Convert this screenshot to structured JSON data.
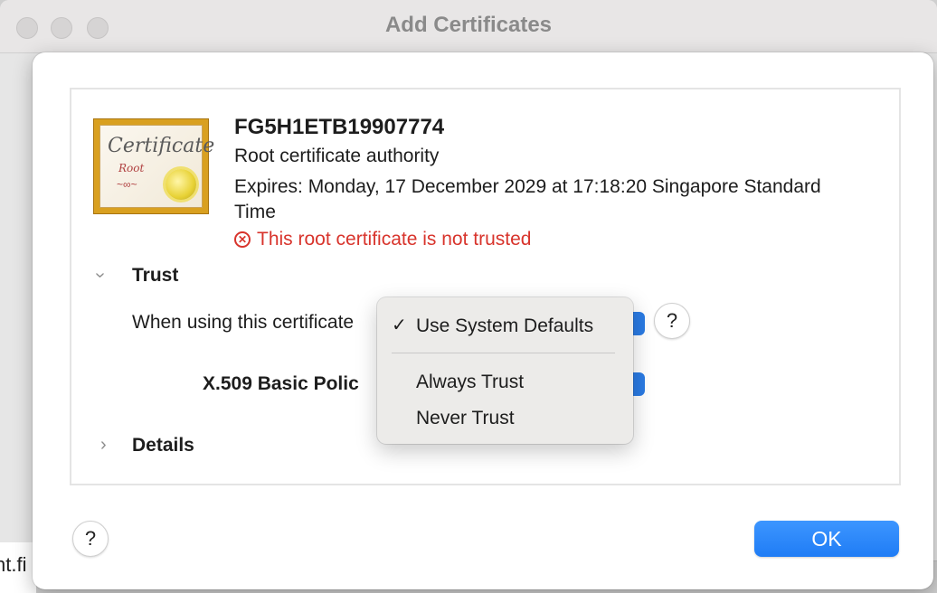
{
  "window": {
    "title": "Add Certificates"
  },
  "background": {
    "partial_text": "nt.fi"
  },
  "certificate": {
    "icon_text": "Certificate",
    "icon_subtext": "Root",
    "name": "FG5H1ETB19907774",
    "type": "Root certificate authority",
    "expires": "Expires: Monday, 17 December 2029 at 17:18:20 Singapore Standard Time",
    "status": "This root certificate is not trusted",
    "status_color": "#d8342c"
  },
  "trust": {
    "section_title": "Trust",
    "when_using_label": "When using this certificate",
    "x509_label": "X.509 Basic Polic",
    "help_label": "?"
  },
  "menu": {
    "items": [
      {
        "label": "Use System Defaults",
        "checked": true
      },
      {
        "label": "Always Trust",
        "checked": false
      },
      {
        "label": "Never Trust",
        "checked": false
      }
    ],
    "check_glyph": "✓"
  },
  "details": {
    "section_title": "Details"
  },
  "footer": {
    "help_label": "?",
    "ok_label": "OK",
    "accent": "#1f7cf5"
  }
}
